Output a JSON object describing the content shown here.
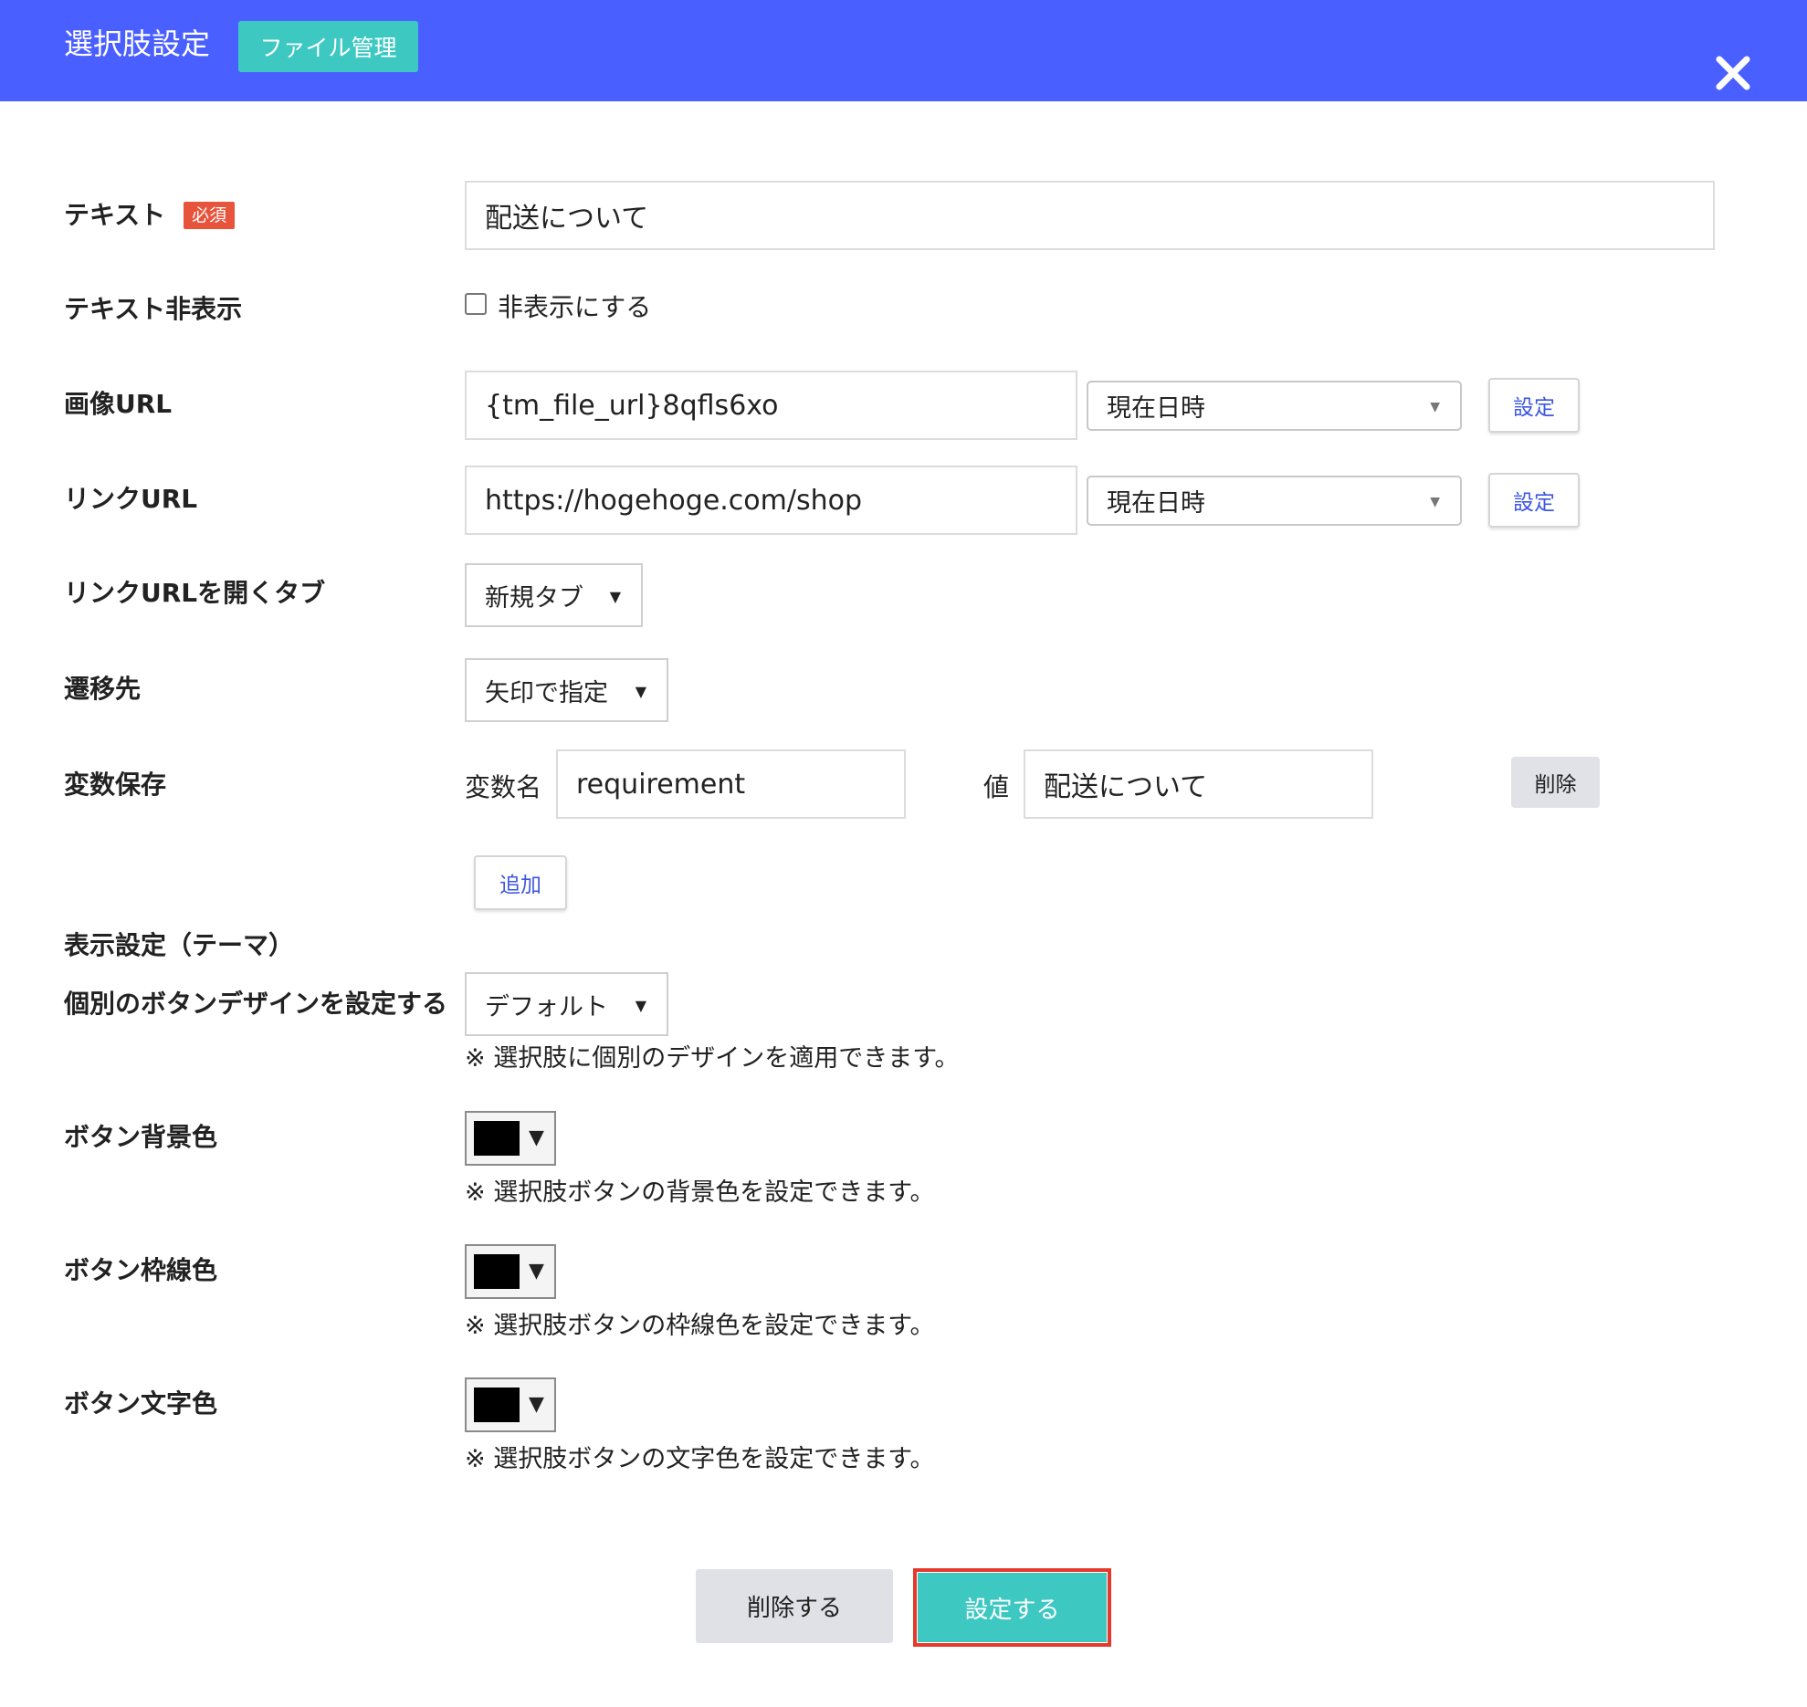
{
  "header": {
    "title": "選択肢設定",
    "file_button": "ファイル管理",
    "close_icon": "close-icon"
  },
  "fields": {
    "text": {
      "label": "テキスト",
      "required_badge": "必須",
      "value": "配送について"
    },
    "hide_text": {
      "label": "テキスト非表示",
      "checkbox_label": "非表示にする",
      "checked": false
    },
    "image_url": {
      "label": "画像URL",
      "value": "{tm_file_url}8qfls6xo",
      "select_value": "現在日時",
      "set_button": "設定"
    },
    "link_url": {
      "label": "リンクURL",
      "value": "https://hogehoge.com/shop",
      "select_value": "現在日時",
      "set_button": "設定"
    },
    "link_target": {
      "label": "リンクURLを開くタブ",
      "select_value": "新規タブ"
    },
    "destination": {
      "label": "遷移先",
      "select_value": "矢印で指定"
    },
    "variable_save": {
      "label": "変数保存",
      "name_caption": "変数名",
      "name_value": "requirement",
      "value_caption": "値",
      "value_value": "配送について",
      "delete_button": "削除",
      "add_button": "追加"
    },
    "theme": {
      "section_label": "表示設定（テーマ）",
      "design_label": "個別のボタンデザインを設定する",
      "design_select": "デフォルト",
      "design_note": "※ 選択肢に個別のデザインを適用できます。"
    },
    "button_bg": {
      "label": "ボタン背景色",
      "color": "#000000",
      "note": "※ 選択肢ボタンの背景色を設定できます。"
    },
    "button_border": {
      "label": "ボタン枠線色",
      "color": "#000000",
      "note": "※ 選択肢ボタンの枠線色を設定できます。"
    },
    "button_text": {
      "label": "ボタン文字色",
      "color": "#000000",
      "note": "※ 選択肢ボタンの文字色を設定できます。"
    }
  },
  "footer": {
    "delete_button": "削除する",
    "submit_button": "設定する"
  },
  "colors": {
    "header_bg": "#4a5fff",
    "accent_teal": "#3ec8c2",
    "required_red": "#e8533b",
    "link_blue": "#3d57e0",
    "highlight_red": "#e53a2b"
  }
}
